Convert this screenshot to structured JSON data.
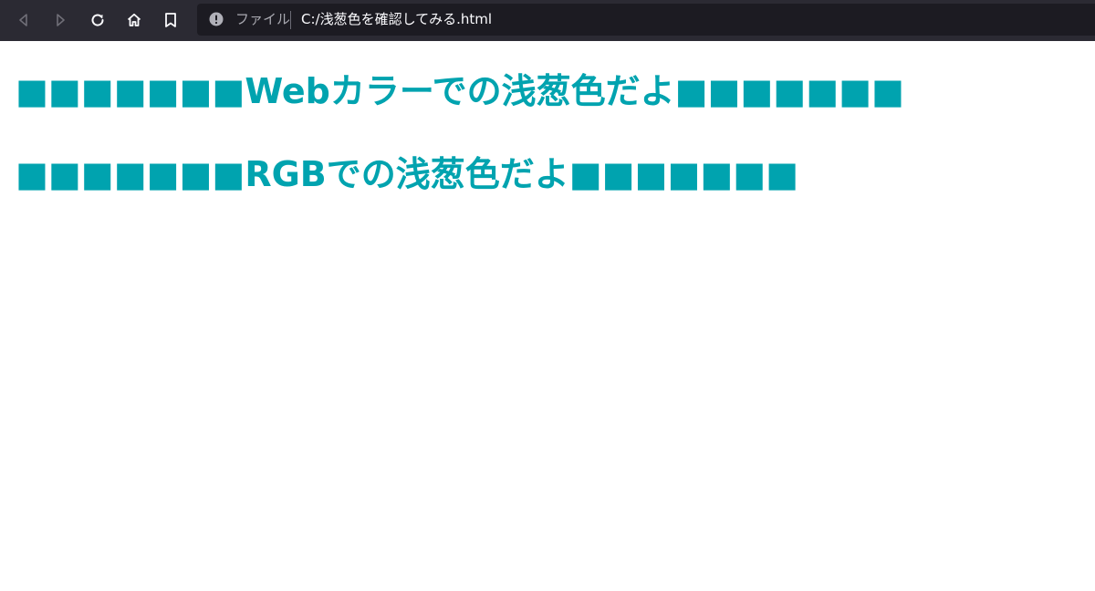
{
  "browser": {
    "site_label": "ファイル",
    "url": "C:/浅葱色を確認してみる.html",
    "toolbar_bg": "#2b2a33",
    "urlbar_bg": "#1c1b22"
  },
  "toolbar": {
    "icons": [
      "back-icon",
      "forward-icon",
      "reload-icon",
      "home-icon",
      "bookmark-icon"
    ]
  },
  "page": {
    "heading_color": "#00a3af",
    "headings": [
      {
        "text": "■■■■■■■Webカラーでの浅葱色だよ■■■■■■■"
      },
      {
        "text": "■■■■■■■RGBでの浅葱色だよ■■■■■■■"
      }
    ]
  }
}
